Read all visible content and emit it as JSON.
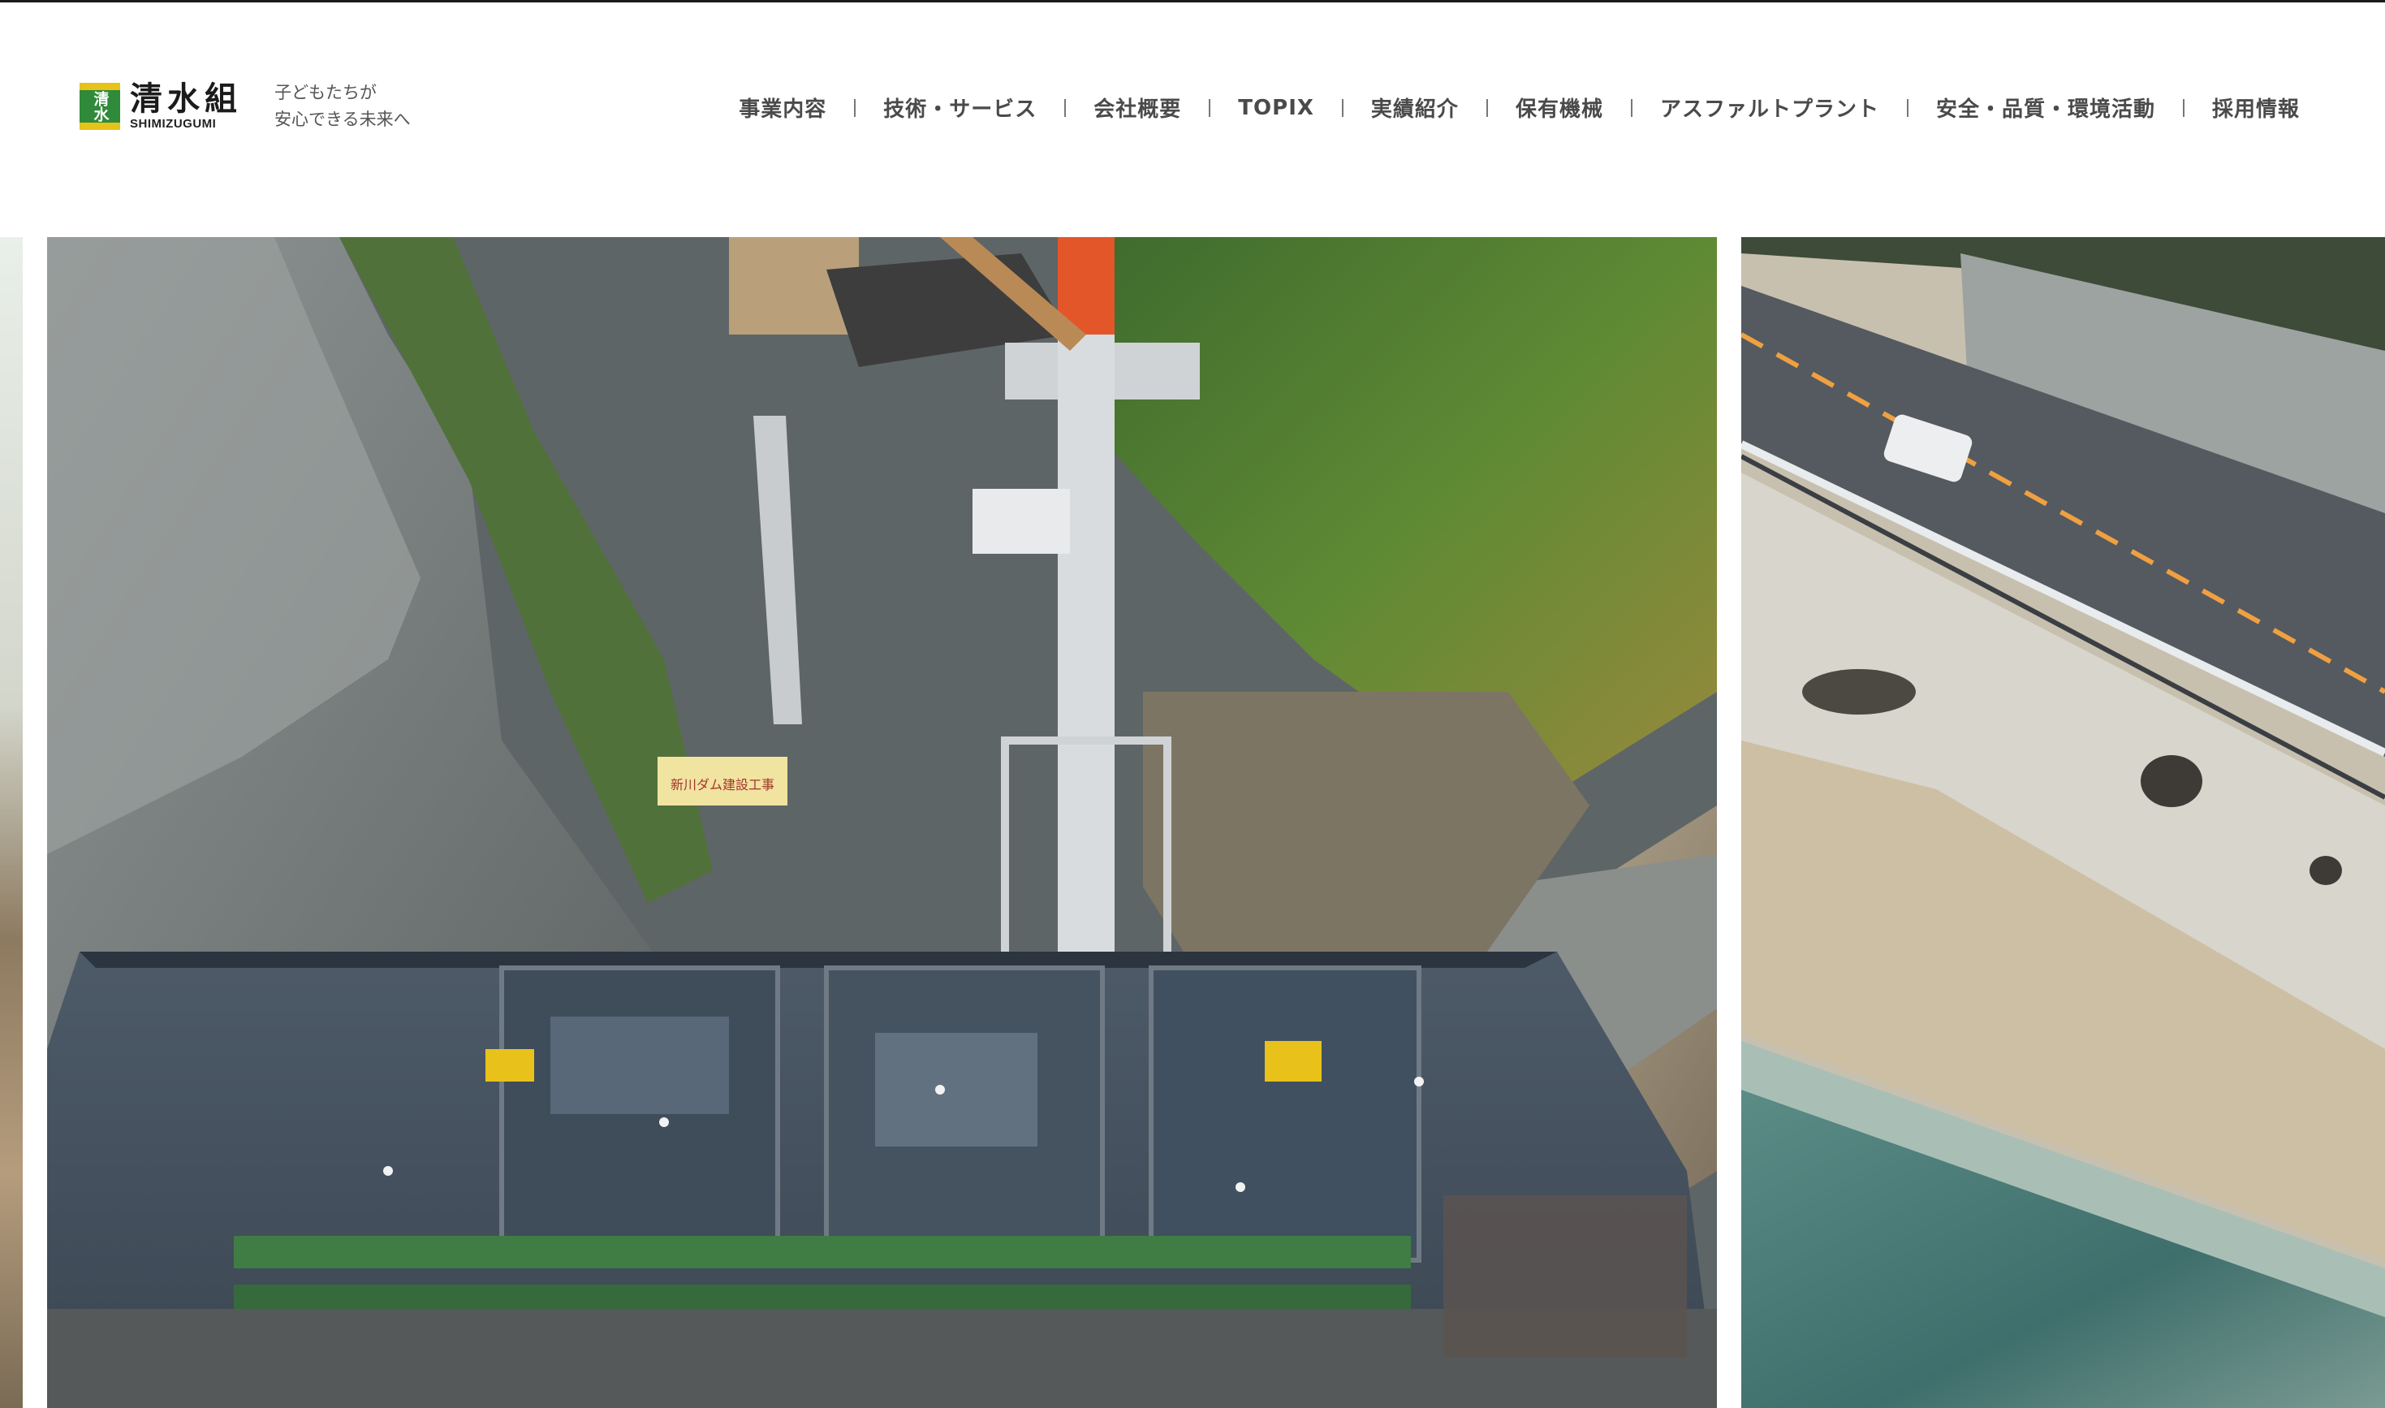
{
  "header": {
    "logo": {
      "mark_glyph": "清水",
      "name_jp": "清水組",
      "name_en": "SHIMIZUGUMI"
    },
    "tagline": [
      "子どもたちが",
      "安心できる未来へ"
    ]
  },
  "nav": {
    "items": [
      {
        "label": "事業内容"
      },
      {
        "label": "技術・サービス"
      },
      {
        "label": "会社概要"
      },
      {
        "label": "TOPIX"
      },
      {
        "label": "実績紹介"
      },
      {
        "label": "保有機械"
      },
      {
        "label": "アスファルトプラント"
      },
      {
        "label": "安全・品質・環境活動"
      },
      {
        "label": "採用情報"
      }
    ]
  },
  "slider": {
    "slides": [
      {
        "scene": "partial-previous-slide"
      },
      {
        "scene": "dam-construction-site",
        "sign_text": "新川ダム建設工事"
      },
      {
        "scene": "coastal-road-and-seawall"
      }
    ]
  },
  "colors": {
    "logo_green": "#2f8a3a",
    "logo_yellow": "#e6c21a",
    "nav_text": "#4a4a4a"
  }
}
